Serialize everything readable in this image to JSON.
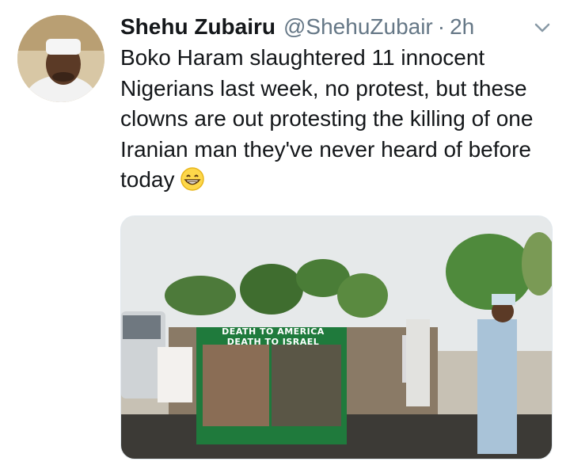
{
  "tweet": {
    "display_name": "Shehu Zubairu",
    "handle": "@ShehuZubair",
    "separator": "·",
    "time": "2h",
    "text": "Boko Haram slaughtered 11 innocent Nigerians last week, no protest, but these clowns are out protesting the killing of one Iranian man they've never heard of before today",
    "emoji": "grinning-face-with-smiling-eyes"
  },
  "media": {
    "banner_line1": "DEATH TO AMERICA",
    "banner_line2": "DEATH TO ISRAEL"
  },
  "colors": {
    "text": "#14171a",
    "secondary": "#657786",
    "banner_green": "#1f7a3c"
  }
}
